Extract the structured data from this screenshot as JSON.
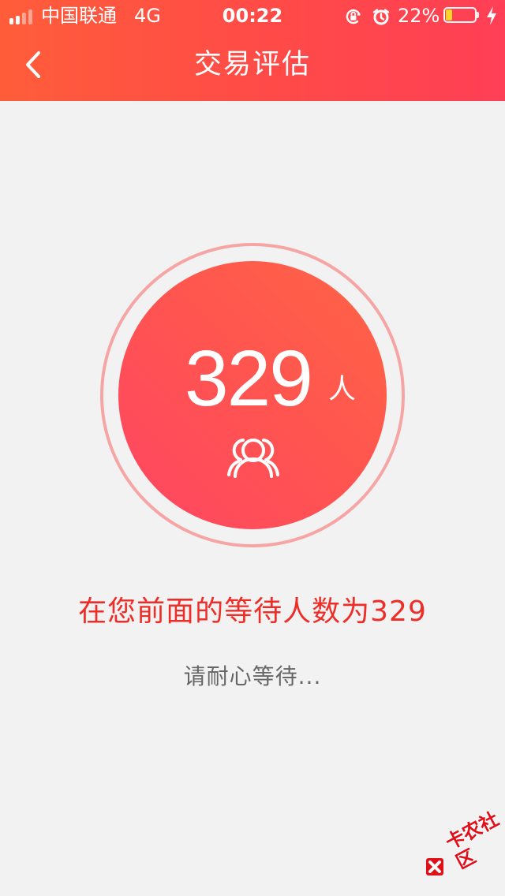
{
  "status_bar": {
    "carrier": "中国联通",
    "network": "4G",
    "time": "00:22",
    "battery_percent": "22%",
    "icons": [
      "signal-strength-icon",
      "orientation-lock-icon",
      "alarm-icon",
      "battery-icon",
      "charging-icon"
    ]
  },
  "nav": {
    "back_icon": "chevron-left-icon",
    "title": "交易评估"
  },
  "queue": {
    "count": "329",
    "unit": "人",
    "icon": "people-icon",
    "message": "在您前面的等待人数为329",
    "hint": "请耐心等待..."
  },
  "watermark": {
    "text": "卡农社区"
  },
  "colors": {
    "header_start": "#ff5d3a",
    "header_end": "#ff3f56",
    "circle": "#ff554f",
    "ring": "#f6a5a5",
    "message": "#ef2d28",
    "hint": "#666666",
    "background": "#f2f2f2"
  }
}
